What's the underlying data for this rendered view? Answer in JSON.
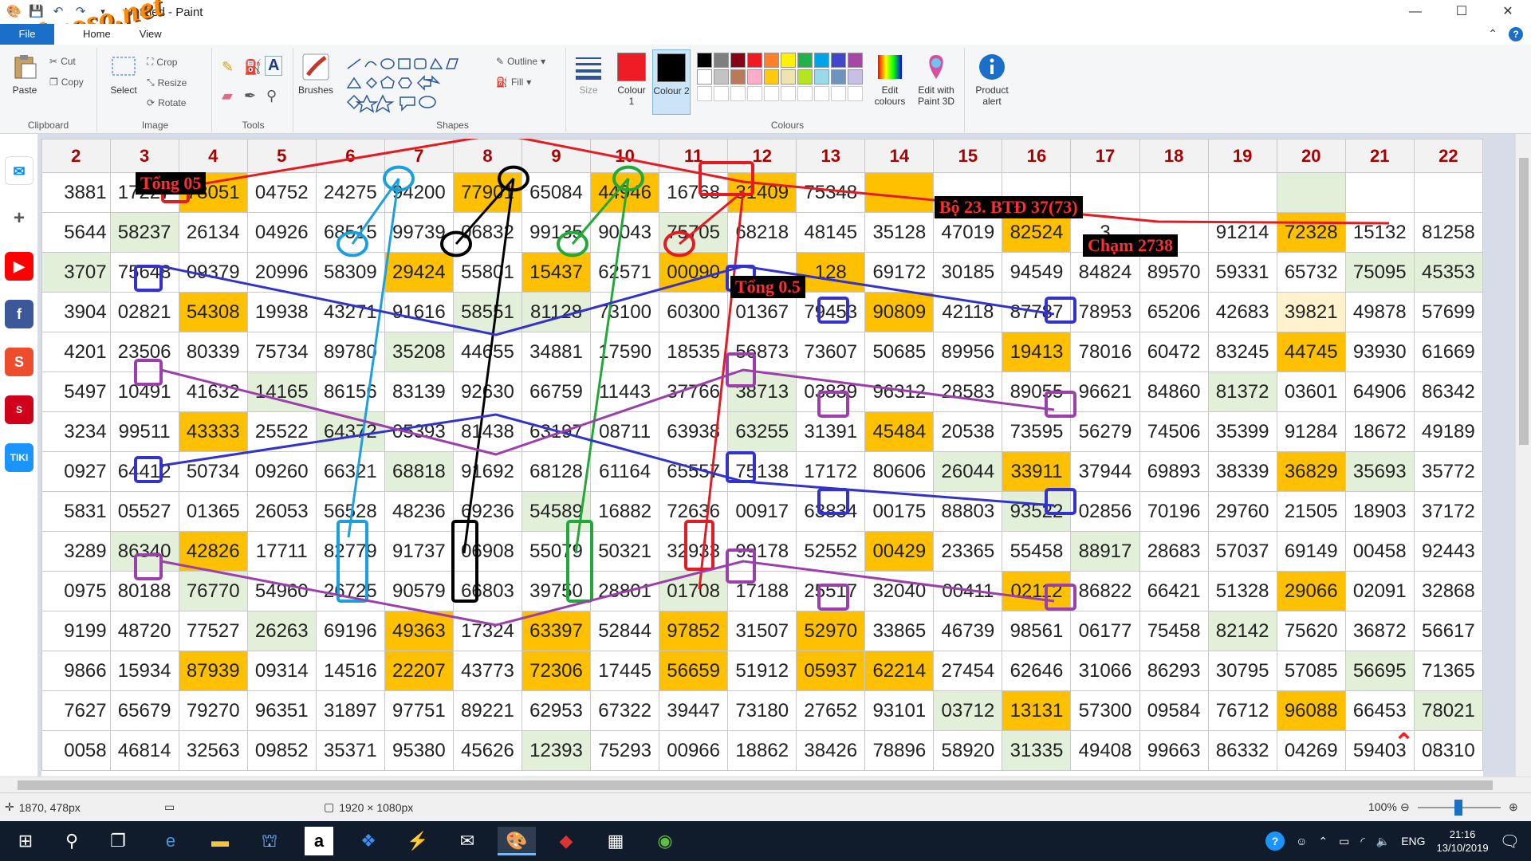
{
  "window": {
    "title": "Untitled - Paint",
    "minimize": "—",
    "maximize": "☐",
    "close": "✕"
  },
  "watermark": "webxoso.net",
  "tabs": [
    "File",
    "Home",
    "View"
  ],
  "ribbon": {
    "clipboard": {
      "label": "Clipboard",
      "paste": "Paste",
      "cut": "Cut",
      "copy": "Copy"
    },
    "image": {
      "label": "Image",
      "select": "Select",
      "crop": "Crop",
      "resize": "Resize",
      "rotate": "Rotate"
    },
    "tools": {
      "label": "Tools"
    },
    "brushes": {
      "label": "Brushes"
    },
    "shapes": {
      "label": "Shapes",
      "outline": "Outline",
      "fill": "Fill"
    },
    "size": {
      "label": "Size"
    },
    "colours": {
      "label": "Colours",
      "colour1": "Colour 1",
      "colour2": "Colour 2",
      "edit": "Edit colours",
      "paint3d": "Edit with Paint 3D",
      "alert": "Product alert",
      "colour1_value": "#ee1c24",
      "colour2_value": "#000000",
      "palette_row1": [
        "#000000",
        "#7f7f7f",
        "#880015",
        "#ed1c24",
        "#ff7f27",
        "#fff200",
        "#22b14c",
        "#00a2e8",
        "#3f48cc",
        "#a349a4"
      ],
      "palette_row2": [
        "#ffffff",
        "#c3c3c3",
        "#b97a57",
        "#ffaec9",
        "#ffc90e",
        "#efe4b0",
        "#b5e61d",
        "#99d9ea",
        "#7092be",
        "#c8bfe7"
      ]
    }
  },
  "sheet": {
    "headers": [
      "2",
      "3",
      "4",
      "5",
      "6",
      "7",
      "8",
      "9",
      "10",
      "11",
      "12",
      "13",
      "14",
      "15",
      "16",
      "17",
      "18",
      "19",
      "20",
      "21",
      "22"
    ],
    "rows": [
      [
        "3881",
        "17227",
        "78051",
        "04752",
        "24275",
        "94200",
        "77901",
        "65084",
        "44946",
        "16768",
        "31409",
        "75348",
        "",
        "",
        "",
        "",
        "",
        "",
        "",
        "",
        ""
      ],
      [
        "5644",
        "58237",
        "26134",
        "04926",
        "68515",
        "99739",
        "06832",
        "99135",
        "90043",
        "75705",
        "68218",
        "48145",
        "35128",
        "47019",
        "82524",
        "3",
        "",
        "91214",
        "72328",
        "15132",
        "81258"
      ],
      [
        "3707",
        "75648",
        "09379",
        "20996",
        "58309",
        "29424",
        "55801",
        "15437",
        "62571",
        "00090",
        "",
        "128",
        "69172",
        "30185",
        "94549",
        "84824",
        "89570",
        "59331",
        "65732",
        "75095",
        "45353"
      ],
      [
        "3904",
        "02821",
        "54308",
        "19938",
        "43271",
        "91616",
        "58551",
        "81128",
        "73100",
        "60300",
        "01367",
        "79453",
        "90809",
        "42118",
        "87787",
        "78953",
        "65206",
        "42683",
        "39821",
        "49878",
        "57699"
      ],
      [
        "4201",
        "23506",
        "80339",
        "75734",
        "89780",
        "35208",
        "44655",
        "34881",
        "17590",
        "18535",
        "56873",
        "73607",
        "50685",
        "89956",
        "19413",
        "78016",
        "60472",
        "83245",
        "44745",
        "93930",
        "61669"
      ],
      [
        "5497",
        "10491",
        "41632",
        "14165",
        "86156",
        "83139",
        "92630",
        "66759",
        "11443",
        "37766",
        "38713",
        "03839",
        "96312",
        "28583",
        "89055",
        "96621",
        "84860",
        "81372",
        "03601",
        "64906",
        "86342"
      ],
      [
        "3234",
        "99511",
        "43333",
        "25522",
        "64372",
        "05393",
        "81438",
        "63197",
        "08711",
        "63938",
        "63255",
        "31391",
        "45484",
        "20538",
        "73595",
        "56279",
        "74506",
        "35399",
        "91284",
        "18672",
        "49189"
      ],
      [
        "0927",
        "64412",
        "50734",
        "09260",
        "66321",
        "68818",
        "91692",
        "68128",
        "61164",
        "65557",
        "75138",
        "17172",
        "80606",
        "26044",
        "33911",
        "37944",
        "69893",
        "38339",
        "36829",
        "35693",
        "35772"
      ],
      [
        "5831",
        "05527",
        "01365",
        "26053",
        "56528",
        "48236",
        "69236",
        "54589",
        "16882",
        "72636",
        "00917",
        "63834",
        "00175",
        "88803",
        "93522",
        "02856",
        "70196",
        "29760",
        "21505",
        "18903",
        "37172"
      ],
      [
        "3289",
        "86340",
        "42826",
        "17711",
        "82779",
        "91737",
        "06908",
        "55079",
        "50321",
        "32933",
        "99178",
        "52552",
        "00429",
        "23365",
        "55458",
        "88917",
        "28683",
        "57037",
        "69149",
        "00458",
        "92443"
      ],
      [
        "0975",
        "80188",
        "76770",
        "54960",
        "26725",
        "90579",
        "66803",
        "39750",
        "28801",
        "01708",
        "17188",
        "25517",
        "32040",
        "00411",
        "02112",
        "86822",
        "66421",
        "51328",
        "29066",
        "02091",
        "32868"
      ],
      [
        "9199",
        "48720",
        "77527",
        "26263",
        "69196",
        "49363",
        "17324",
        "63397",
        "52844",
        "97852",
        "31507",
        "52970",
        "33865",
        "46739",
        "98561",
        "06177",
        "75458",
        "82142",
        "75620",
        "36872",
        "56617"
      ],
      [
        "9866",
        "15934",
        "87939",
        "09314",
        "14516",
        "22207",
        "43773",
        "72306",
        "17445",
        "56659",
        "51912",
        "05937",
        "62214",
        "27454",
        "62646",
        "31066",
        "86293",
        "30795",
        "57085",
        "56695",
        "71365"
      ],
      [
        "7627",
        "65679",
        "79270",
        "96351",
        "31897",
        "97751",
        "89221",
        "62953",
        "67322",
        "39447",
        "73180",
        "27652",
        "93101",
        "03712",
        "13131",
        "57300",
        "09584",
        "76712",
        "96088",
        "66453",
        "78021"
      ],
      [
        "0058",
        "46814",
        "32563",
        "09852",
        "35371",
        "95380",
        "45626",
        "12393",
        "75293",
        "00966",
        "18862",
        "38426",
        "78896",
        "58920",
        "31335",
        "49408",
        "99663",
        "86332",
        "04269",
        "59403",
        "08310"
      ]
    ],
    "annotations": [
      "Tổng 05",
      "Bộ 23. BTĐ 37(73)",
      "Chạm 2738",
      "Tổng 0.5"
    ]
  },
  "status": {
    "cursor": "1870, 478px",
    "dimensions": "1920 × 1080px",
    "zoom": "100%"
  },
  "taskbar": {
    "lang": "ENG",
    "time": "21:16",
    "date": "13/10/2019"
  }
}
